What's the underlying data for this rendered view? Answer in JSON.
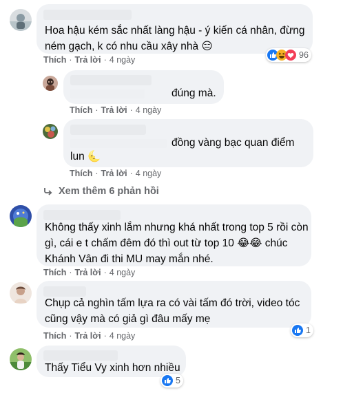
{
  "comments": [
    {
      "id": "c1",
      "text": "Hoa hậu kém sắc nhất làng hậu - ý kiến cá nhân, đừng ném gạch, k có nhu cầu xây nhà 😑",
      "actions": {
        "like": "Thích",
        "reply": "Trả lời",
        "time": "4 ngày"
      },
      "reactions": {
        "count": "96",
        "types": [
          "like-icon",
          "haha-icon",
          "love-icon"
        ]
      }
    },
    {
      "id": "r1",
      "text": "đúng mà.",
      "actions": {
        "like": "Thích",
        "reply": "Trả lời",
        "time": "4 ngày"
      }
    },
    {
      "id": "r2",
      "text_line1": "đồng vàng bạc quan điểm",
      "text_line2": "lun 🌜",
      "actions": {
        "like": "Thích",
        "reply": "Trả lời",
        "time": "4 ngày"
      }
    },
    {
      "id": "c2",
      "text": "Không thấy xinh lắm nhưng khá nhất trong top 5 rồi còn gì, cái e t chấm đêm đó thì out từ top 10 😂😂 chúc Khánh Vân đi thi MU may mắn nhé.",
      "actions": {
        "like": "Thích",
        "reply": "Trả lời",
        "time": "4 ngày"
      }
    },
    {
      "id": "c3",
      "text": "Chụp cả nghìn tấm lựa ra có vài tấm đó trời, video tóc cũng vậy mà có giả gì đâu mấy mẹ",
      "actions": {
        "like": "Thích",
        "reply": "Trả lời",
        "time": "4 ngày"
      },
      "reactions": {
        "count": "1",
        "types": [
          "like-icon"
        ]
      }
    },
    {
      "id": "c4",
      "text": "Thấy Tiểu Vy xinh hơn nhiều",
      "reactions": {
        "count": "5",
        "types": [
          "like-icon"
        ]
      }
    }
  ],
  "more_replies": {
    "label": "Xem thêm 6 phản hồi",
    "icon": "reply-arrow-icon"
  },
  "colors": {
    "bubble": "#f0f2f5",
    "meta": "#65676b",
    "like_blue": "#1877f2",
    "love_red": "#f33e58",
    "haha_yellow": "#f7b125"
  }
}
